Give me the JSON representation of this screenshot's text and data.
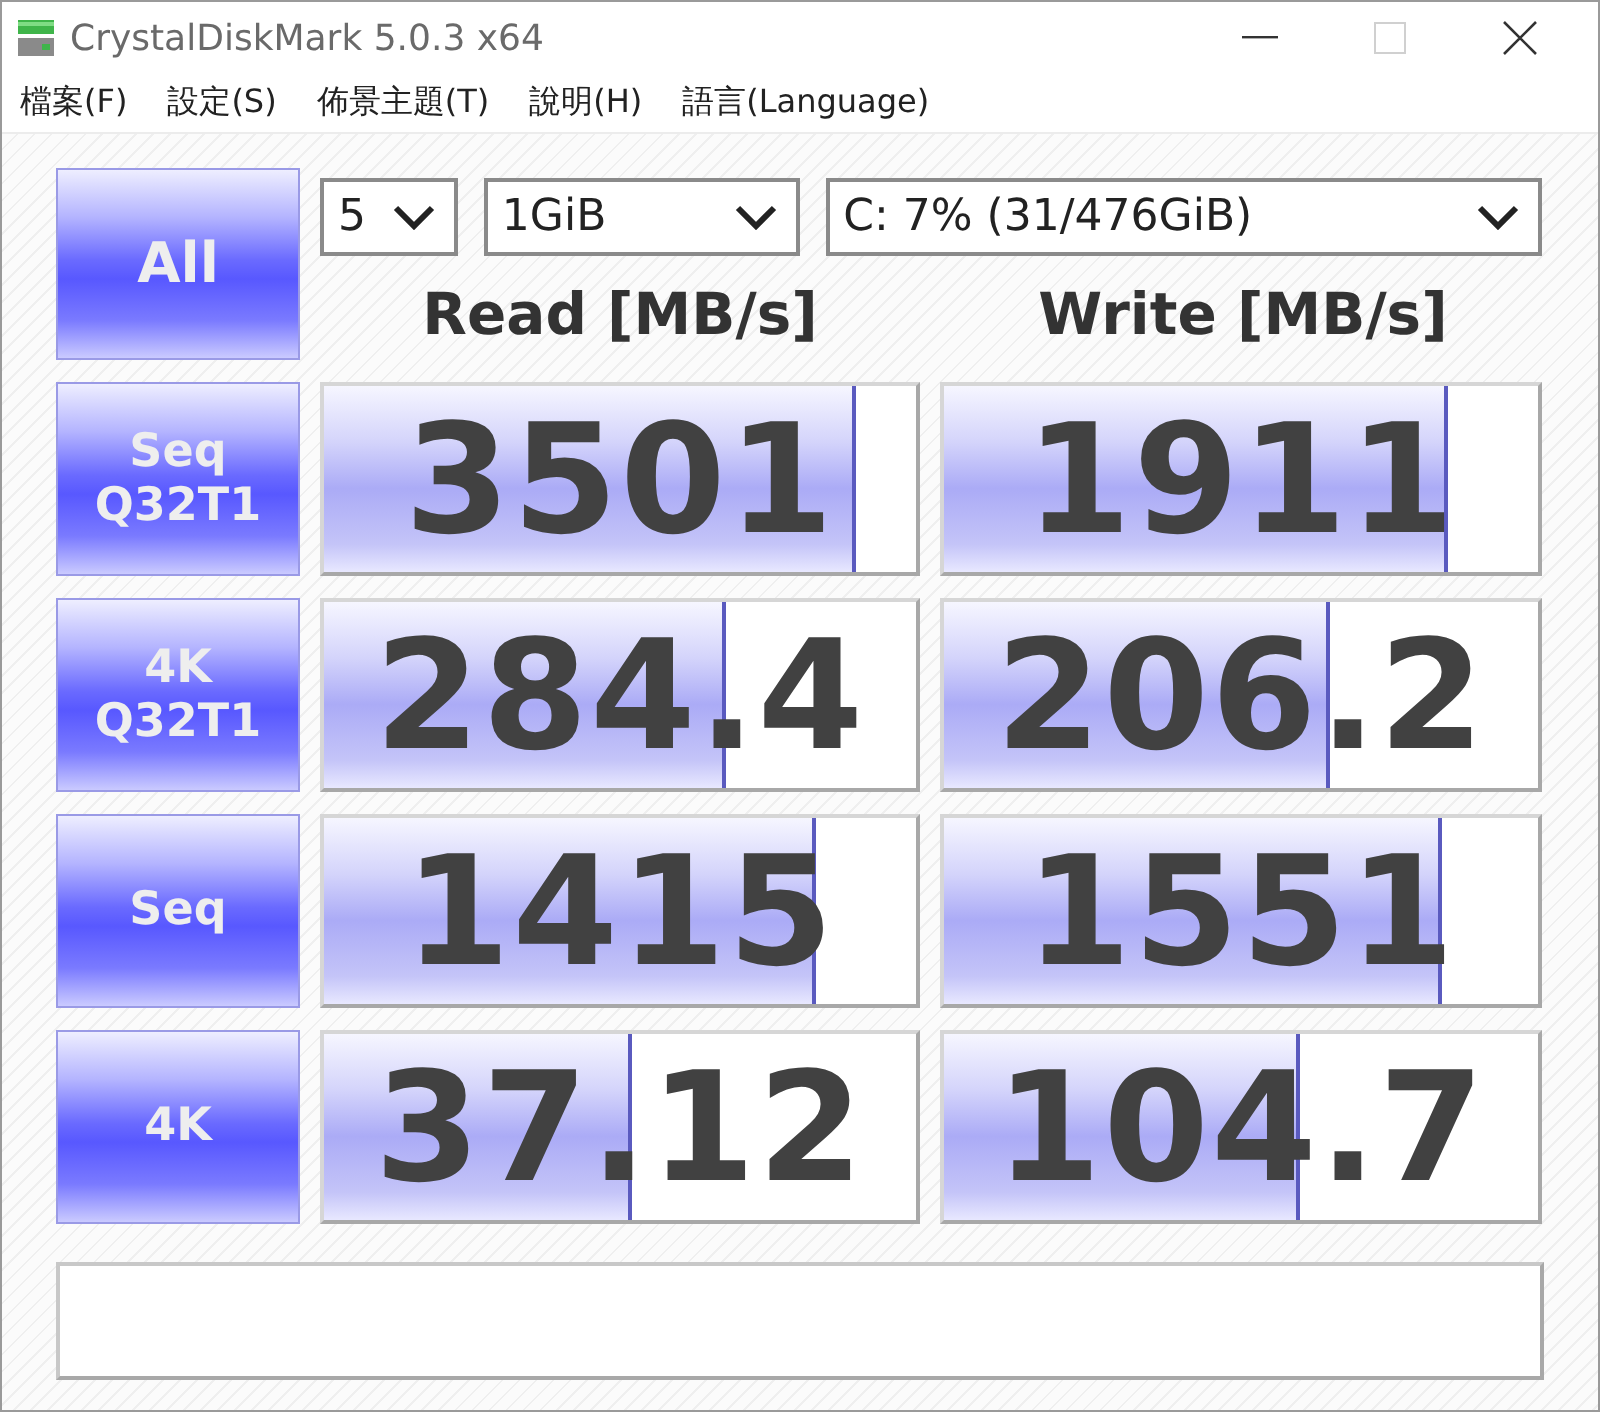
{
  "window": {
    "title": "CrystalDiskMark 5.0.3 x64",
    "maximize_disabled": true
  },
  "menu": [
    {
      "label": "檔案(F)"
    },
    {
      "label": "設定(S)"
    },
    {
      "label": "佈景主題(T)"
    },
    {
      "label": "說明(H)"
    },
    {
      "label": "語言(Language)"
    }
  ],
  "toolbar": {
    "run_all": "All",
    "count": "5",
    "size": "1GiB",
    "drive": "C: 7% (31/476GiB)"
  },
  "columns": [
    "Read [MB/s]",
    "Write [MB/s]"
  ],
  "tests": [
    {
      "label": "Seq Q32T1",
      "read": {
        "value": "3501",
        "level": 0.9
      },
      "write": {
        "value": "1911",
        "level": 0.85
      }
    },
    {
      "label": "4K Q32T1",
      "read": {
        "value": "284.4",
        "level": 0.68
      },
      "write": {
        "value": "206.2",
        "level": 0.65
      }
    },
    {
      "label": "Seq",
      "read": {
        "value": "1415",
        "level": 0.83
      },
      "write": {
        "value": "1551",
        "level": 0.84
      }
    },
    {
      "label": "4K",
      "read": {
        "value": "37.12",
        "level": 0.52
      },
      "write": {
        "value": "104.7",
        "level": 0.6
      }
    }
  ]
}
